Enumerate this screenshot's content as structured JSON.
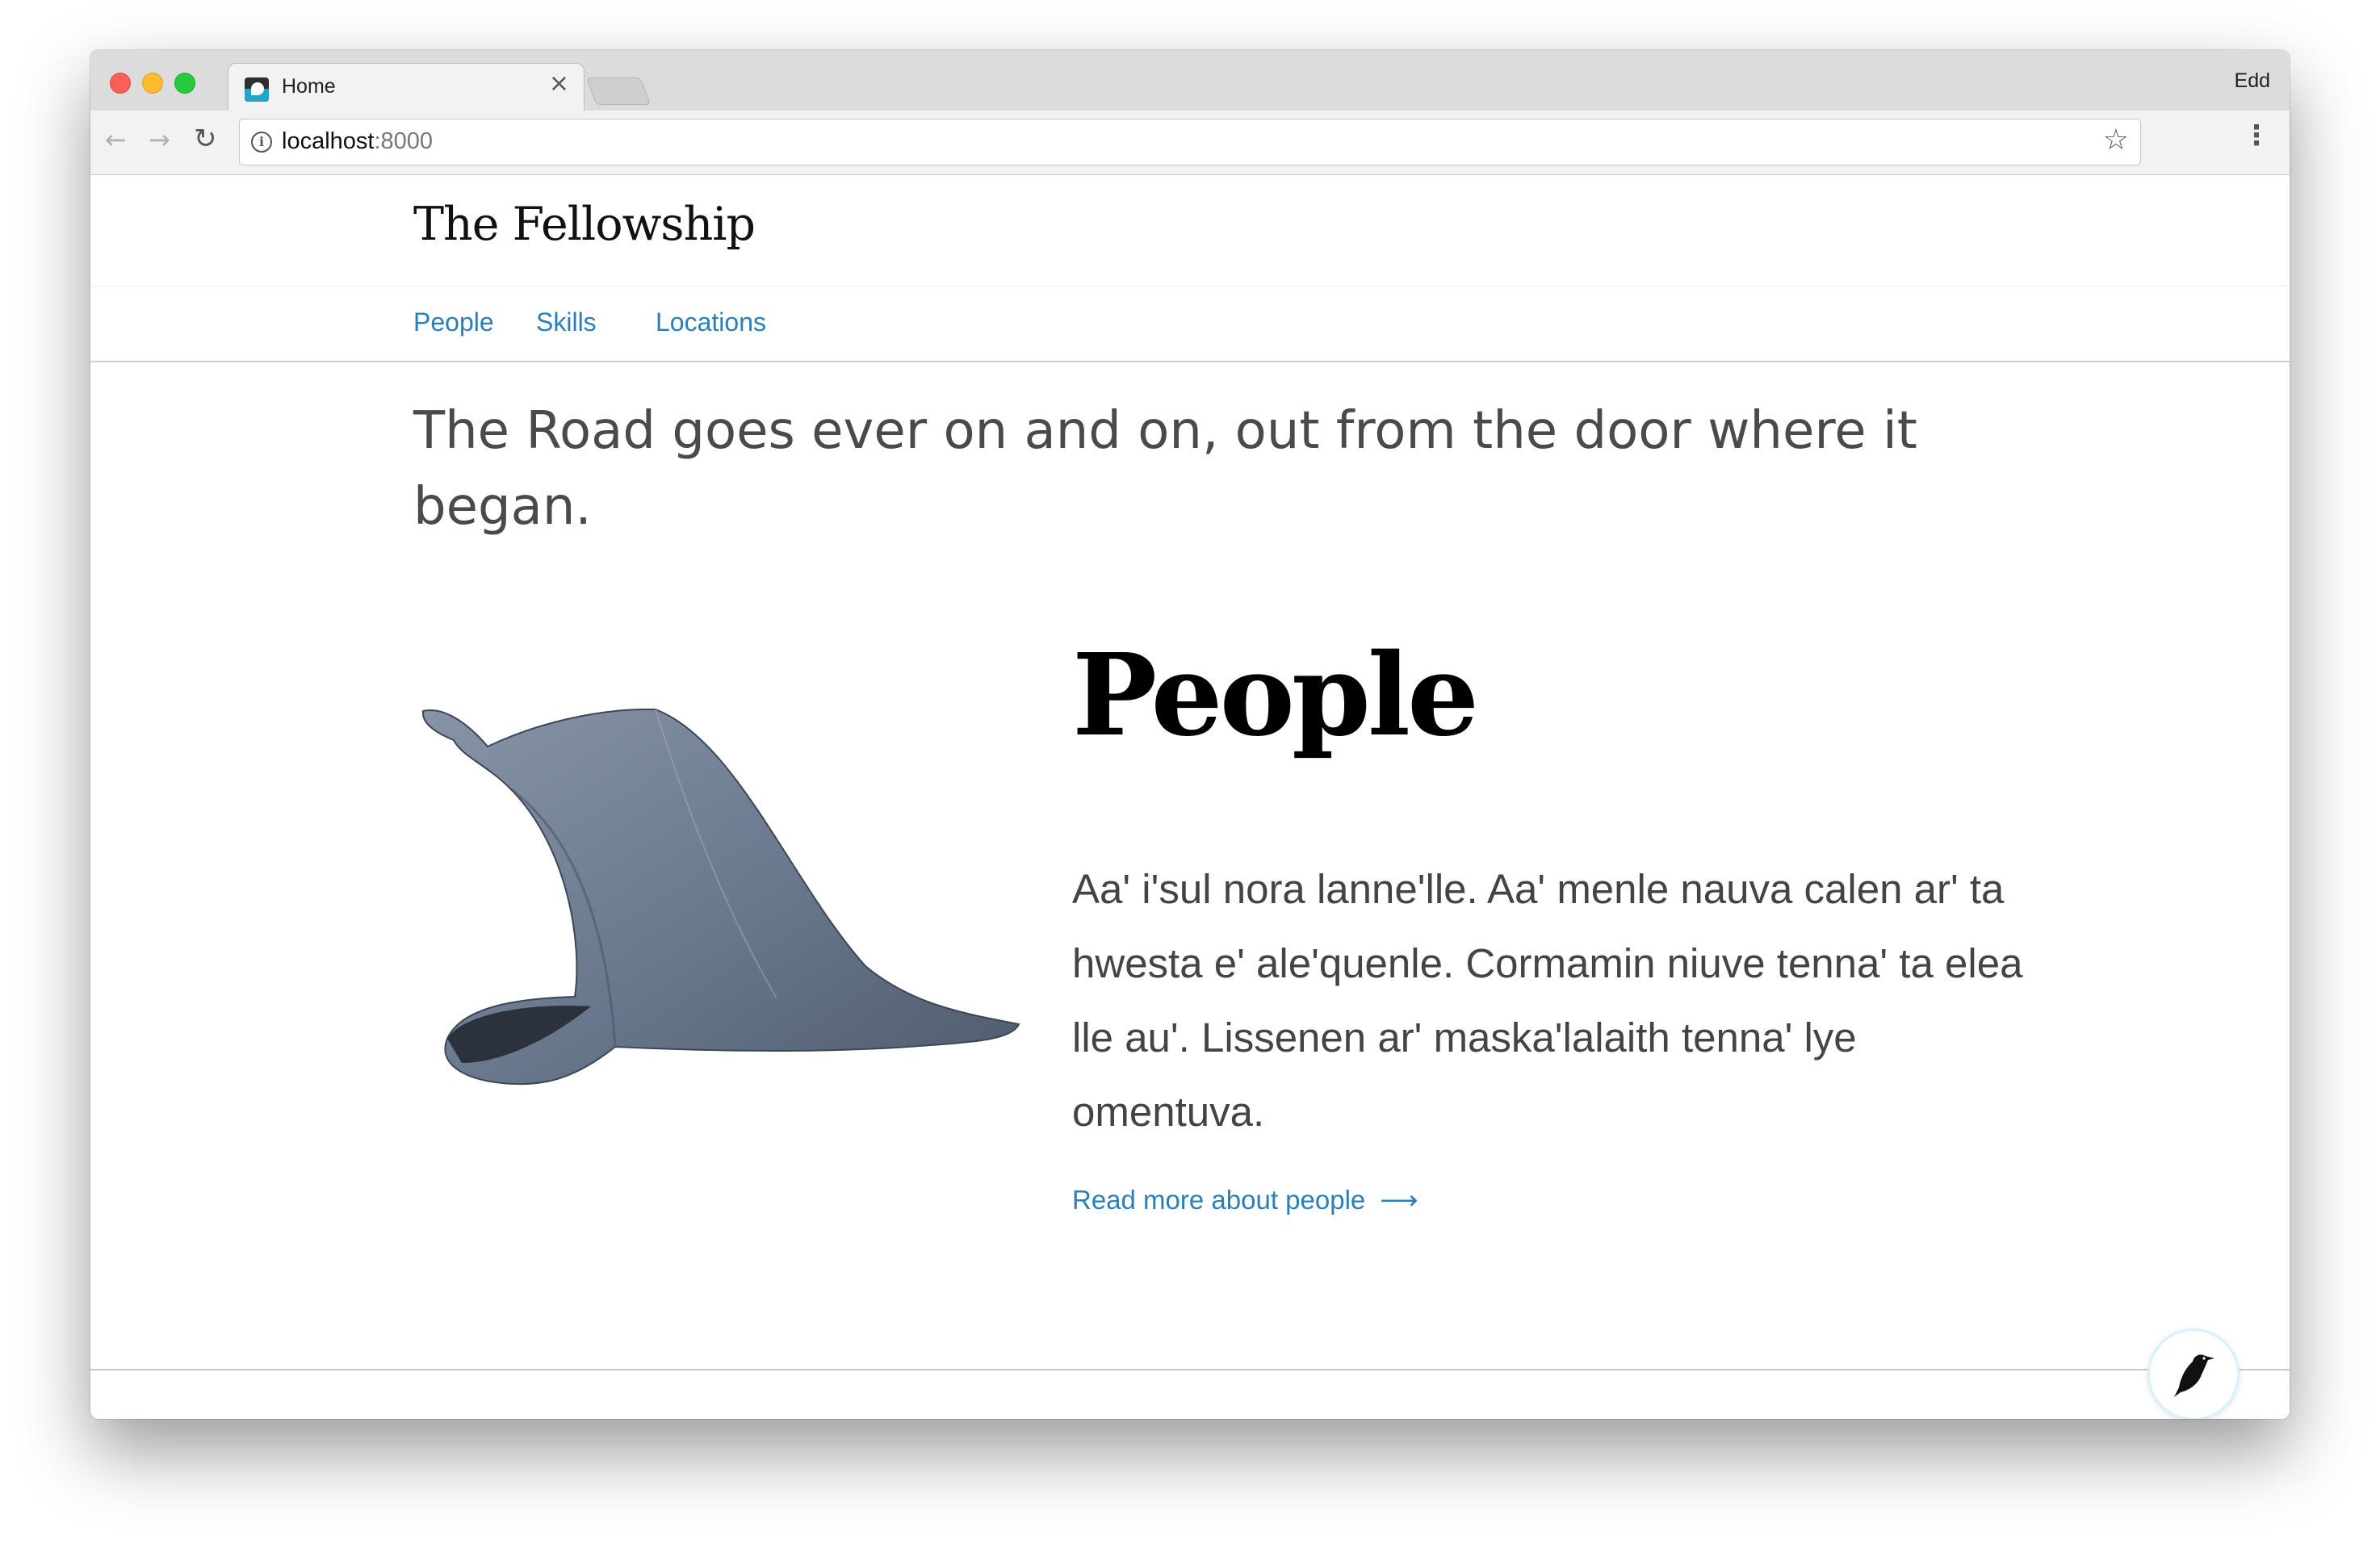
{
  "browser": {
    "tab_title": "Home",
    "tab_close": "×",
    "profile_name": "Edd",
    "url_host": "localhost",
    "url_port": ":8000"
  },
  "site": {
    "title": "The Fellowship",
    "nav": [
      {
        "label": "People"
      },
      {
        "label": "Skills"
      },
      {
        "label": "Locations"
      }
    ]
  },
  "main": {
    "intro": "The Road goes ever on and on, out from the door where it began.",
    "section_title": "People",
    "section_body": "Aa' i'sul nora lanne'lle. Aa' menle nauva calen ar' ta hwesta e' ale'quenle. Cormamin niuve tenna' ta elea lle au'. Lissenen ar' maska'lalaith tenna' lye omentuva.",
    "read_more": "Read more about people",
    "read_more_arrow": "⟶"
  },
  "icons": {
    "back": "arrow-left-icon",
    "forward": "arrow-right-icon",
    "reload": "reload-icon",
    "info": "info-icon",
    "star": "star-icon",
    "menu": "kebab-menu-icon",
    "fab": "bird-icon",
    "image": "wizard-hat-image"
  },
  "colors": {
    "link": "#2b7fb8",
    "hat": "#6b7a8f"
  }
}
